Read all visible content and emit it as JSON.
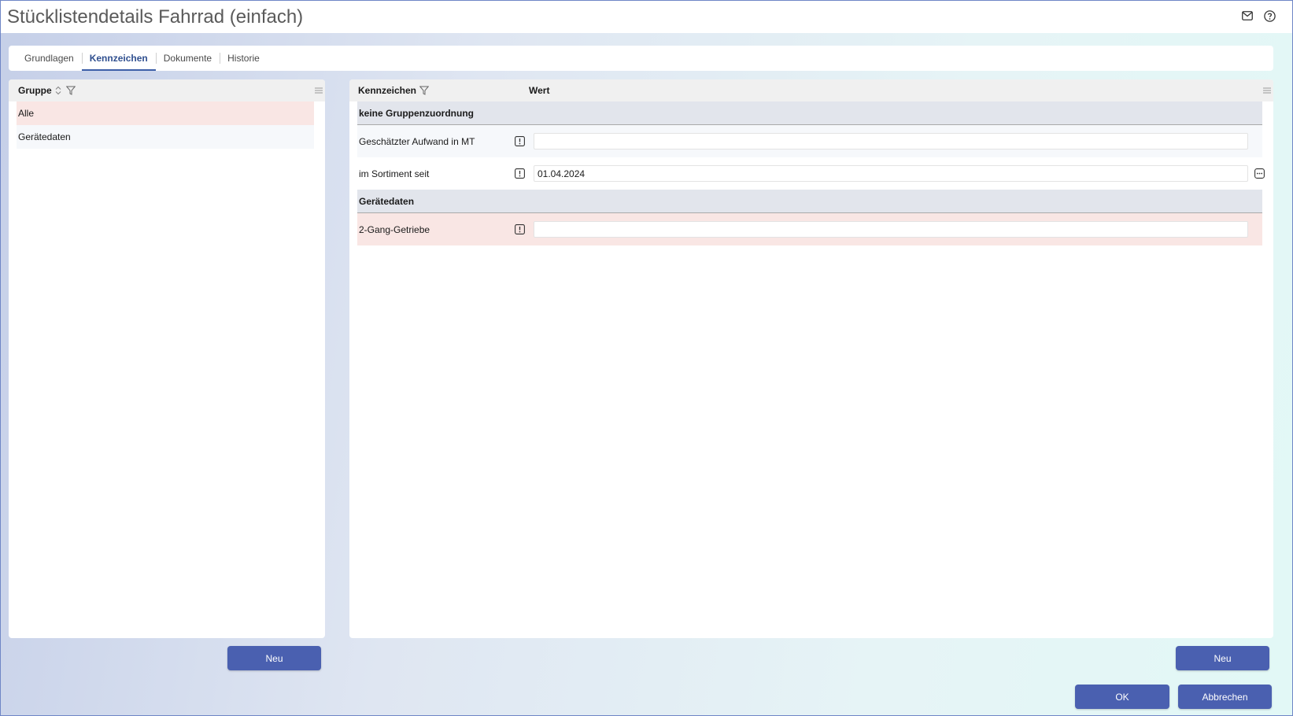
{
  "window": {
    "title": "Stücklistendetails Fahrrad (einfach)",
    "icons": [
      "mail-icon",
      "help-icon"
    ]
  },
  "tabs": [
    {
      "label": "Grundlagen",
      "active": false
    },
    {
      "label": "Kennzeichen",
      "active": true
    },
    {
      "label": "Dokumente",
      "active": false
    },
    {
      "label": "Historie",
      "active": false
    }
  ],
  "left_panel": {
    "header": "Gruppe",
    "rows": [
      {
        "label": "Alle",
        "selected": true
      },
      {
        "label": "Gerätedaten",
        "selected": false
      }
    ],
    "new_button": "Neu"
  },
  "right_panel": {
    "header_kennzeichen": "Kennzeichen",
    "header_wert": "Wert",
    "sections": [
      {
        "title": "keine Gruppenzuordnung",
        "rows": [
          {
            "label": "Geschätzter Aufwand in MT",
            "value": ""
          },
          {
            "label": "im Sortiment seit",
            "value": "01.04.2024"
          }
        ]
      },
      {
        "title": "Gerätedaten",
        "rows": [
          {
            "label": "2-Gang-Getriebe",
            "value": ""
          }
        ]
      }
    ],
    "new_button": "Neu"
  },
  "footer": {
    "ok_label": "OK",
    "cancel_label": "Abbrechen"
  },
  "colors": {
    "accent": "#4a60b0",
    "selected_row": "#f9e6e4",
    "section_bg": "#e2e5ec"
  }
}
